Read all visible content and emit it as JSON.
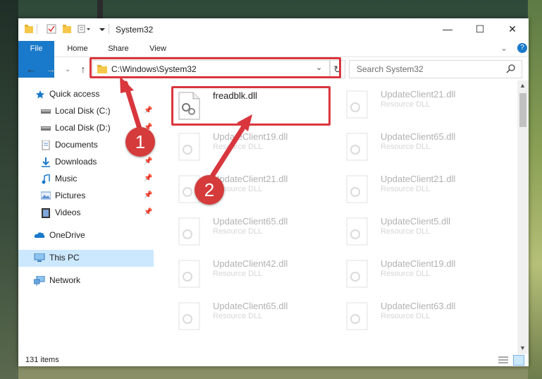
{
  "window": {
    "title": "System32"
  },
  "ribbon": {
    "tabs": [
      "File",
      "Home",
      "Share",
      "View"
    ]
  },
  "address": {
    "path": "C:\\Windows\\System32"
  },
  "search": {
    "placeholder": "Search System32"
  },
  "nav": {
    "items": [
      {
        "label": "Quick access",
        "icon": "star-icon"
      },
      {
        "label": "Local Disk (C:)",
        "icon": "drive-icon",
        "pinned": true
      },
      {
        "label": "Local Disk (D:)",
        "icon": "drive-icon",
        "pinned": true
      },
      {
        "label": "Documents",
        "icon": "documents-icon",
        "pinned": true
      },
      {
        "label": "Downloads",
        "icon": "download-icon",
        "pinned": true
      },
      {
        "label": "Music",
        "icon": "music-icon",
        "pinned": true
      },
      {
        "label": "Pictures",
        "icon": "pictures-icon",
        "pinned": true
      },
      {
        "label": "Videos",
        "icon": "videos-icon",
        "pinned": true
      },
      {
        "label": "OneDrive",
        "icon": "cloud-icon"
      },
      {
        "label": "This PC",
        "icon": "computer-icon"
      },
      {
        "label": "Network",
        "icon": "network-icon"
      }
    ]
  },
  "files": {
    "highlighted": {
      "name": "freadblk.dll"
    },
    "col1": [
      {
        "name": "UpdateClient19.dll",
        "type": "Resource DLL"
      },
      {
        "name": "UpdateClient21.dll",
        "type": "Resource DLL"
      },
      {
        "name": "UpdateClient65.dll",
        "type": "Resource DLL"
      },
      {
        "name": "UpdateClient42.dll",
        "type": "Resource DLL"
      },
      {
        "name": "UpdateClient65.dll",
        "type": "Resource DLL"
      }
    ],
    "col2": [
      {
        "name": "UpdateClient21.dll",
        "type": "Resource DLL"
      },
      {
        "name": "UpdateClient65.dll",
        "type": "Resource DLL"
      },
      {
        "name": "UpdateClient21.dll",
        "type": "Resource DLL"
      },
      {
        "name": "UpdateClient5.dll",
        "type": "Resource DLL"
      },
      {
        "name": "UpdateClient19.dll",
        "type": "Resource DLL"
      },
      {
        "name": "UpdateClient63.dll",
        "type": "Resource DLL"
      }
    ]
  },
  "status": {
    "items": "131 items"
  },
  "annotations": {
    "step1": "1",
    "step2": "2"
  },
  "colors": {
    "accent": "#1979ca",
    "annotation": "#d9363e",
    "selected": "#cce8ff"
  }
}
